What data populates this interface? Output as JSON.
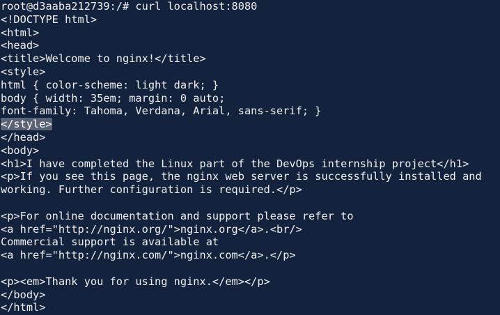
{
  "terminal": {
    "background": "#13223d",
    "foreground": "#f0f0f0",
    "selection_background": "#5a6375",
    "lines": [
      {
        "text": "root@d3aaba212739:/# curl localhost:8080",
        "selected": false
      },
      {
        "text": "<!DOCTYPE html>",
        "selected": false
      },
      {
        "text": "<html>",
        "selected": false
      },
      {
        "text": "<head>",
        "selected": false
      },
      {
        "text": "<title>Welcome to nginx!</title>",
        "selected": false
      },
      {
        "text": "<style>",
        "selected": false
      },
      {
        "text": "html { color-scheme: light dark; }",
        "selected": false
      },
      {
        "text": "body { width: 35em; margin: 0 auto;",
        "selected": false
      },
      {
        "text": "font-family: Tahoma, Verdana, Arial, sans-serif; }",
        "selected": false
      },
      {
        "text": "</style>",
        "selected": true
      },
      {
        "text": "</head>",
        "selected": false
      },
      {
        "text": "<body>",
        "selected": false
      },
      {
        "text": "<h1>I have completed the Linux part of the DevOps internship project</h1>",
        "selected": false
      },
      {
        "text": "<p>If you see this page, the nginx web server is successfully installed and",
        "selected": false
      },
      {
        "text": "working. Further configuration is required.</p>",
        "selected": false
      },
      {
        "text": "",
        "selected": false
      },
      {
        "text": "<p>For online documentation and support please refer to",
        "selected": false
      },
      {
        "text": "<a href=\"http://nginx.org/\">nginx.org</a>.<br/>",
        "selected": false
      },
      {
        "text": "Commercial support is available at",
        "selected": false
      },
      {
        "text": "<a href=\"http://nginx.com/\">nginx.com</a>.</p>",
        "selected": false
      },
      {
        "text": "",
        "selected": false
      },
      {
        "text": "<p><em>Thank you for using nginx.</em></p>",
        "selected": false
      },
      {
        "text": "</body>",
        "selected": false
      },
      {
        "text": "</html>",
        "selected": false
      }
    ]
  }
}
